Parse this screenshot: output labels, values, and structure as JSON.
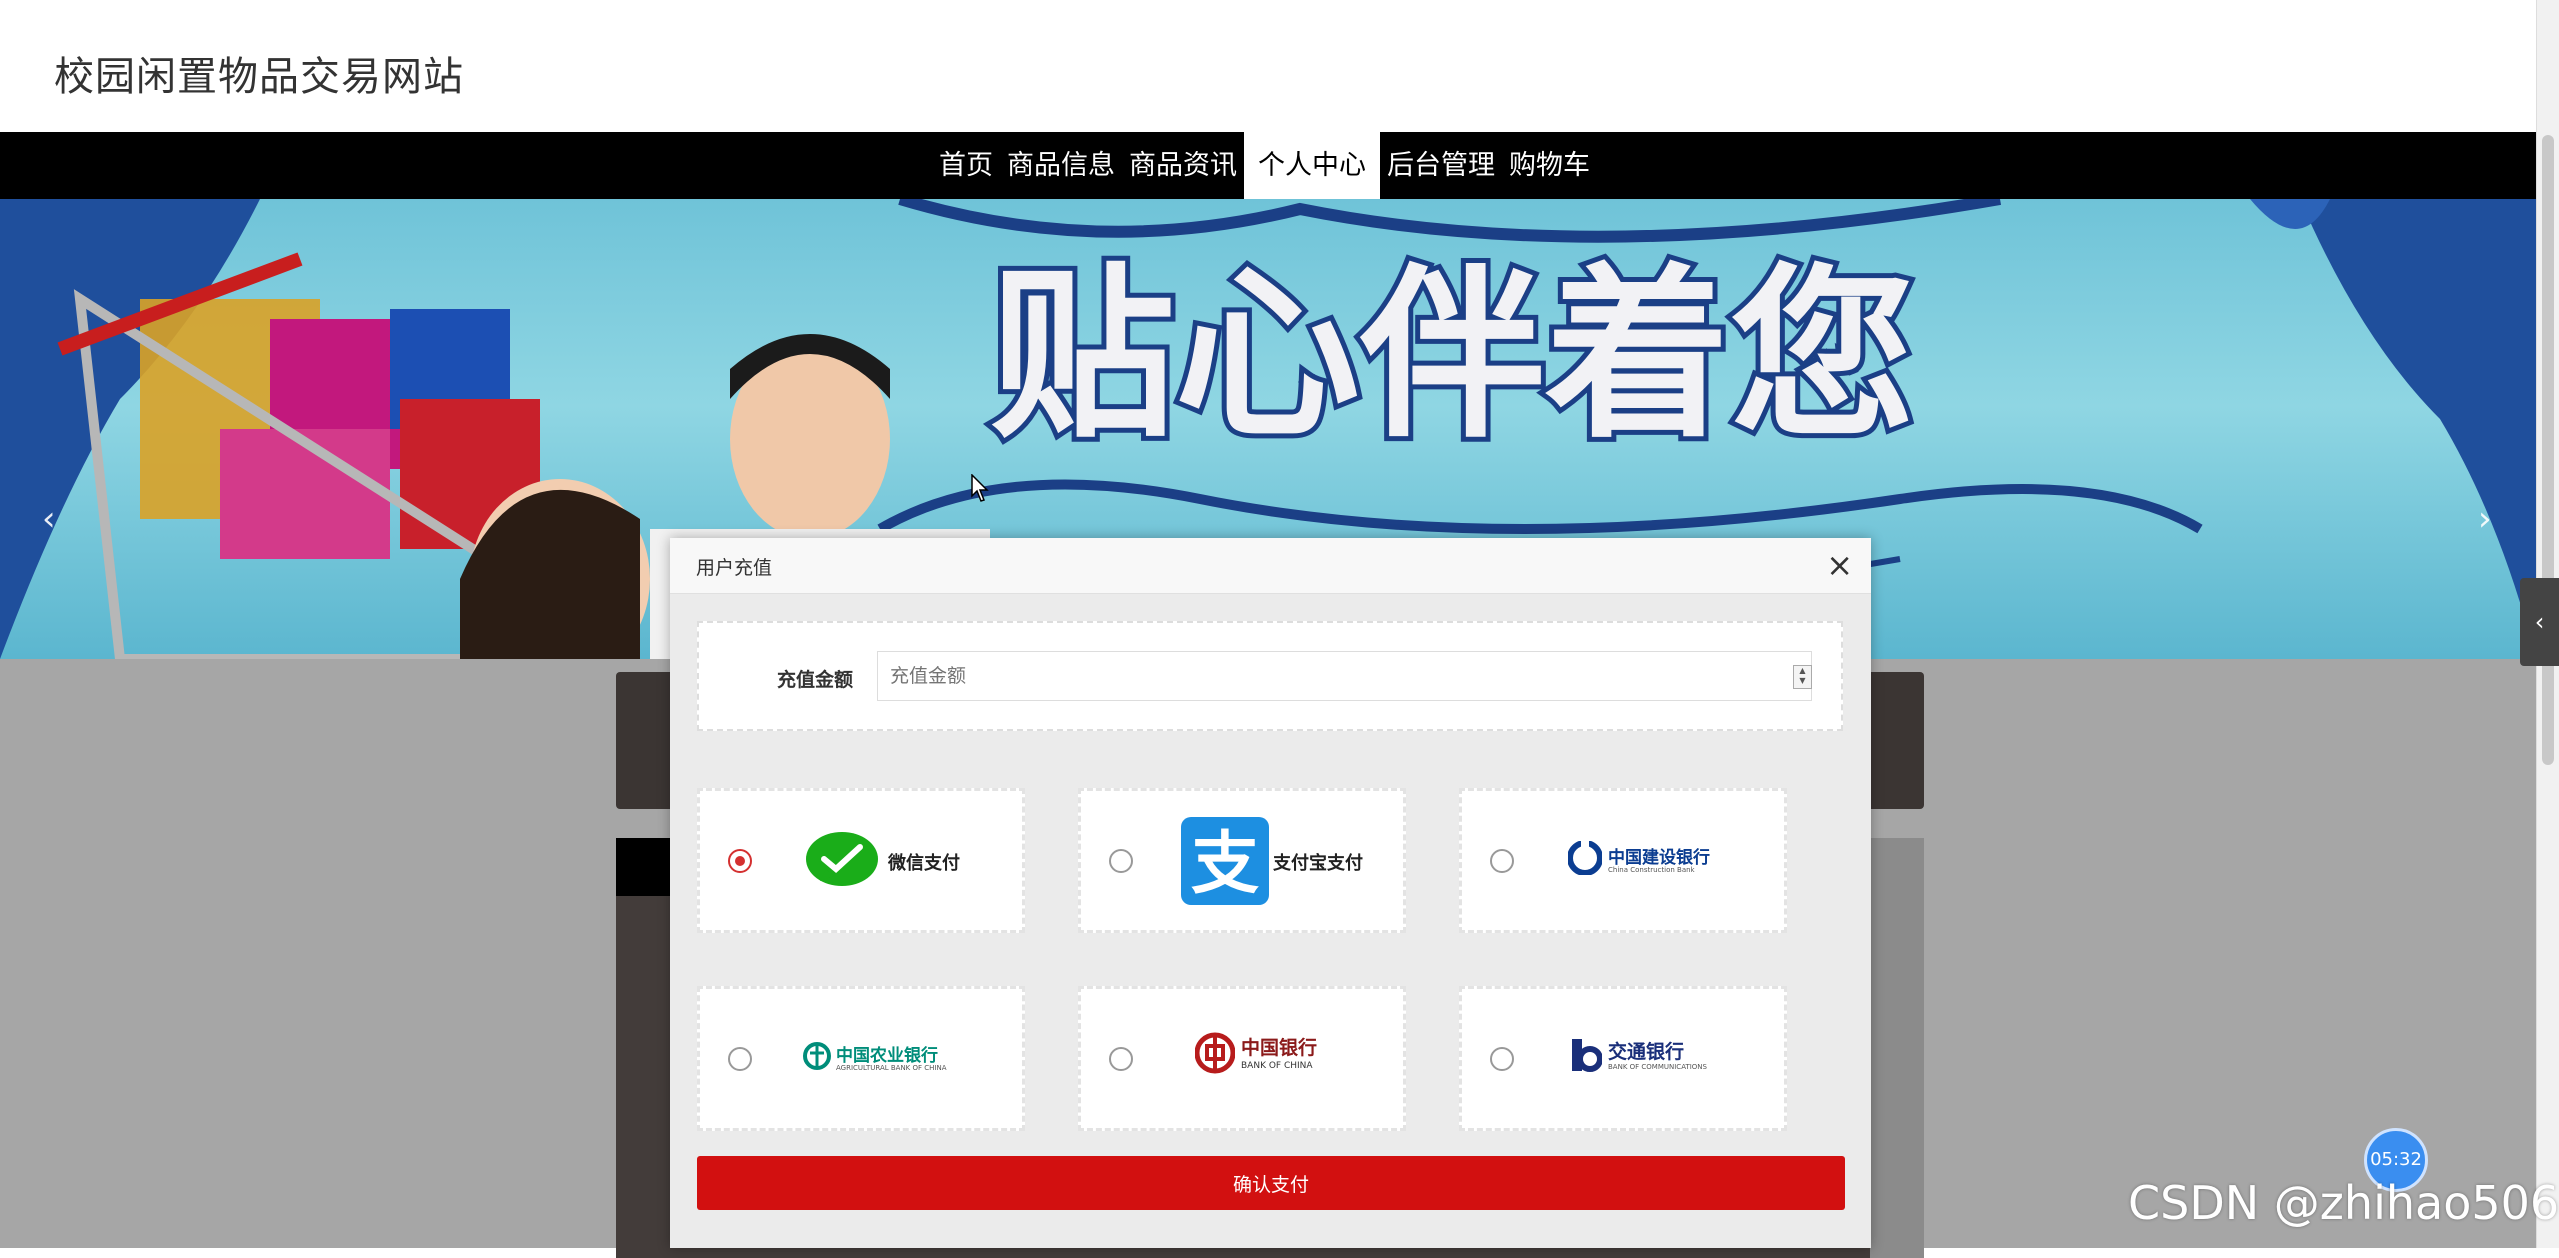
{
  "header": {
    "site_title": "校园闲置物品交易网站"
  },
  "nav": {
    "items": [
      {
        "label": "首页",
        "active": false
      },
      {
        "label": "商品信息",
        "active": false
      },
      {
        "label": "商品资讯",
        "active": false
      },
      {
        "label": "个人中心",
        "active": true
      },
      {
        "label": "后台管理",
        "active": false
      },
      {
        "label": "购物车",
        "active": false
      }
    ]
  },
  "banner": {
    "prev_icon": "‹",
    "next_icon": "›",
    "slogan": "贴心伴着您"
  },
  "modal": {
    "title": "用户充值",
    "close_icon": "×",
    "amount_label": "充值金额",
    "amount_placeholder": "充值金额",
    "amount_value": "",
    "payment_methods": [
      {
        "label": "微信支付",
        "selected": true,
        "icon": "wechat-pay-icon",
        "color": "#1aad19"
      },
      {
        "label": "支付宝支付",
        "selected": false,
        "icon": "alipay-icon",
        "color": "#1d8fe1"
      },
      {
        "label": "中国建设银行",
        "sub": "China Construction Bank",
        "selected": false,
        "icon": "ccb-icon",
        "color": "#0b3d91"
      },
      {
        "label": "中国农业银行",
        "sub": "AGRICULTURAL BANK OF CHINA",
        "selected": false,
        "icon": "abc-icon",
        "color": "#008d7a"
      },
      {
        "label": "中国银行",
        "sub": "BANK OF CHINA",
        "selected": false,
        "icon": "boc-icon",
        "color": "#b71c1c"
      },
      {
        "label": "交通银行",
        "sub": "BANK OF COMMUNICATIONS",
        "selected": false,
        "icon": "bocom-icon",
        "color": "#1a2f7a"
      }
    ],
    "confirm_label": "确认支付"
  },
  "overlay": {
    "timer": "05:32",
    "watermark": "CSDN @zhihao506",
    "side_tab_icon": "‹"
  },
  "colors": {
    "accent_red": "#d21010",
    "radio_selected": "#d43030",
    "nav_bg": "#000000"
  }
}
